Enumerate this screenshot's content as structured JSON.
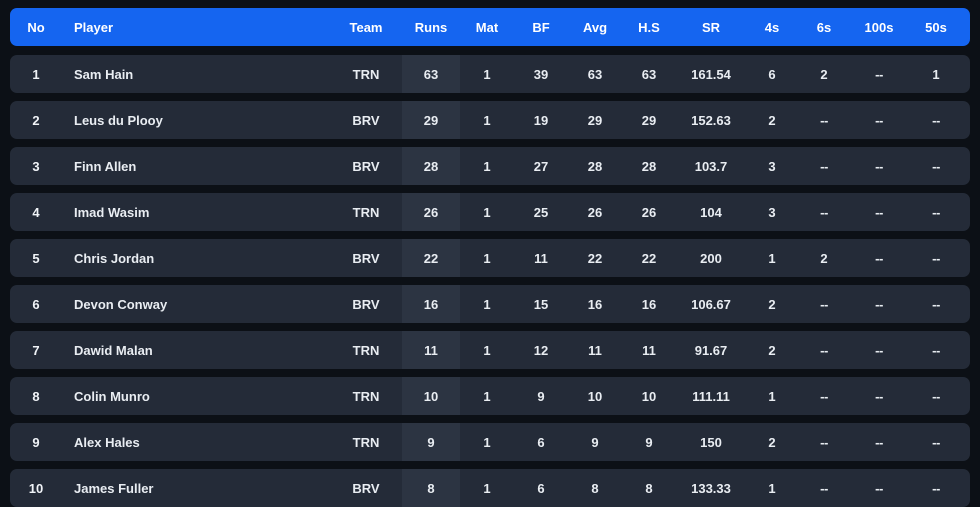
{
  "table": {
    "columns": [
      {
        "key": "no",
        "label": "No"
      },
      {
        "key": "player",
        "label": "Player"
      },
      {
        "key": "team",
        "label": "Team"
      },
      {
        "key": "runs",
        "label": "Runs"
      },
      {
        "key": "mat",
        "label": "Mat"
      },
      {
        "key": "bf",
        "label": "BF"
      },
      {
        "key": "avg",
        "label": "Avg"
      },
      {
        "key": "hs",
        "label": "H.S"
      },
      {
        "key": "sr",
        "label": "SR"
      },
      {
        "key": "fours",
        "label": "4s"
      },
      {
        "key": "sixes",
        "label": "6s"
      },
      {
        "key": "hundreds",
        "label": "100s"
      },
      {
        "key": "fifties",
        "label": "50s"
      }
    ],
    "rows": [
      {
        "no": "1",
        "player": "Sam Hain",
        "team": "TRN",
        "runs": "63",
        "mat": "1",
        "bf": "39",
        "avg": "63",
        "hs": "63",
        "sr": "161.54",
        "fours": "6",
        "sixes": "2",
        "hundreds": "--",
        "fifties": "1"
      },
      {
        "no": "2",
        "player": "Leus du Plooy",
        "team": "BRV",
        "runs": "29",
        "mat": "1",
        "bf": "19",
        "avg": "29",
        "hs": "29",
        "sr": "152.63",
        "fours": "2",
        "sixes": "--",
        "hundreds": "--",
        "fifties": "--"
      },
      {
        "no": "3",
        "player": "Finn Allen",
        "team": "BRV",
        "runs": "28",
        "mat": "1",
        "bf": "27",
        "avg": "28",
        "hs": "28",
        "sr": "103.7",
        "fours": "3",
        "sixes": "--",
        "hundreds": "--",
        "fifties": "--"
      },
      {
        "no": "4",
        "player": "Imad Wasim",
        "team": "TRN",
        "runs": "26",
        "mat": "1",
        "bf": "25",
        "avg": "26",
        "hs": "26",
        "sr": "104",
        "fours": "3",
        "sixes": "--",
        "hundreds": "--",
        "fifties": "--"
      },
      {
        "no": "5",
        "player": "Chris Jordan",
        "team": "BRV",
        "runs": "22",
        "mat": "1",
        "bf": "11",
        "avg": "22",
        "hs": "22",
        "sr": "200",
        "fours": "1",
        "sixes": "2",
        "hundreds": "--",
        "fifties": "--"
      },
      {
        "no": "6",
        "player": "Devon Conway",
        "team": "BRV",
        "runs": "16",
        "mat": "1",
        "bf": "15",
        "avg": "16",
        "hs": "16",
        "sr": "106.67",
        "fours": "2",
        "sixes": "--",
        "hundreds": "--",
        "fifties": "--"
      },
      {
        "no": "7",
        "player": "Dawid Malan",
        "team": "TRN",
        "runs": "11",
        "mat": "1",
        "bf": "12",
        "avg": "11",
        "hs": "11",
        "sr": "91.67",
        "fours": "2",
        "sixes": "--",
        "hundreds": "--",
        "fifties": "--"
      },
      {
        "no": "8",
        "player": "Colin Munro",
        "team": "TRN",
        "runs": "10",
        "mat": "1",
        "bf": "9",
        "avg": "10",
        "hs": "10",
        "sr": "111.11",
        "fours": "1",
        "sixes": "--",
        "hundreds": "--",
        "fifties": "--"
      },
      {
        "no": "9",
        "player": "Alex Hales",
        "team": "TRN",
        "runs": "9",
        "mat": "1",
        "bf": "6",
        "avg": "9",
        "hs": "9",
        "sr": "150",
        "fours": "2",
        "sixes": "--",
        "hundreds": "--",
        "fifties": "--"
      },
      {
        "no": "10",
        "player": "James Fuller",
        "team": "BRV",
        "runs": "8",
        "mat": "1",
        "bf": "6",
        "avg": "8",
        "hs": "8",
        "sr": "133.33",
        "fours": "1",
        "sixes": "--",
        "hundreds": "--",
        "fifties": "--"
      }
    ]
  },
  "colors": {
    "header_blue": "#1565f0",
    "row_background": "#242b38",
    "runs_highlight": "#2c3442",
    "page_background": "#0c1016",
    "link_blue": "#8ab4f8",
    "dash_gray": "#79818f"
  }
}
